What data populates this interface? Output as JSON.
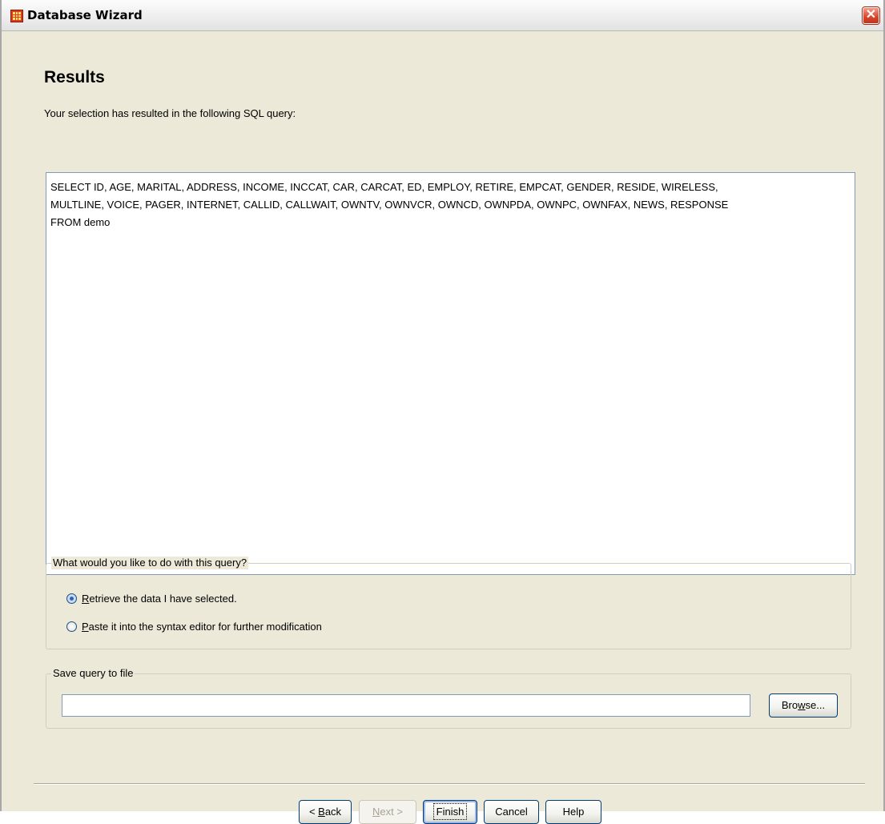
{
  "window": {
    "title": "Database Wizard",
    "icon": "spreadsheet-grid-icon",
    "close_glyph": "✕"
  },
  "page": {
    "heading": "Results",
    "intro": "Your selection has resulted in the following SQL query:"
  },
  "sql": {
    "query": "SELECT ID, AGE, MARITAL, ADDRESS, INCOME, INCCAT, CAR, CARCAT, ED, EMPLOY, RETIRE, EMPCAT, GENDER, RESIDE, WIRELESS,\nMULTLINE, VOICE, PAGER, INTERNET, CALLID, CALLWAIT, OWNTV, OWNVCR, OWNCD, OWNPDA, OWNPC, OWNFAX, NEWS, RESPONSE\nFROM demo"
  },
  "action_group": {
    "legend": "What would you like to do with this query?",
    "options": [
      {
        "mnemonic": "R",
        "rest": "etrieve the data I have selected.",
        "selected": true
      },
      {
        "mnemonic": "P",
        "rest": "aste it into the syntax editor for further modification",
        "selected": false
      }
    ]
  },
  "save_group": {
    "legend": "Save query to file",
    "file_value": "",
    "browse_pre": "Bro",
    "browse_mnemonic": "w",
    "browse_post": "se..."
  },
  "buttons": {
    "back_pre": "< ",
    "back_mnemonic": "B",
    "back_post": "ack",
    "next_pre": "",
    "next_mnemonic": "N",
    "next_post": "ext >",
    "finish": "Finish",
    "cancel": "Cancel",
    "help": "Help"
  },
  "colors": {
    "dialog_bg": "#ece9d8",
    "button_border": "#003c74",
    "close_red": "#d8452b"
  }
}
